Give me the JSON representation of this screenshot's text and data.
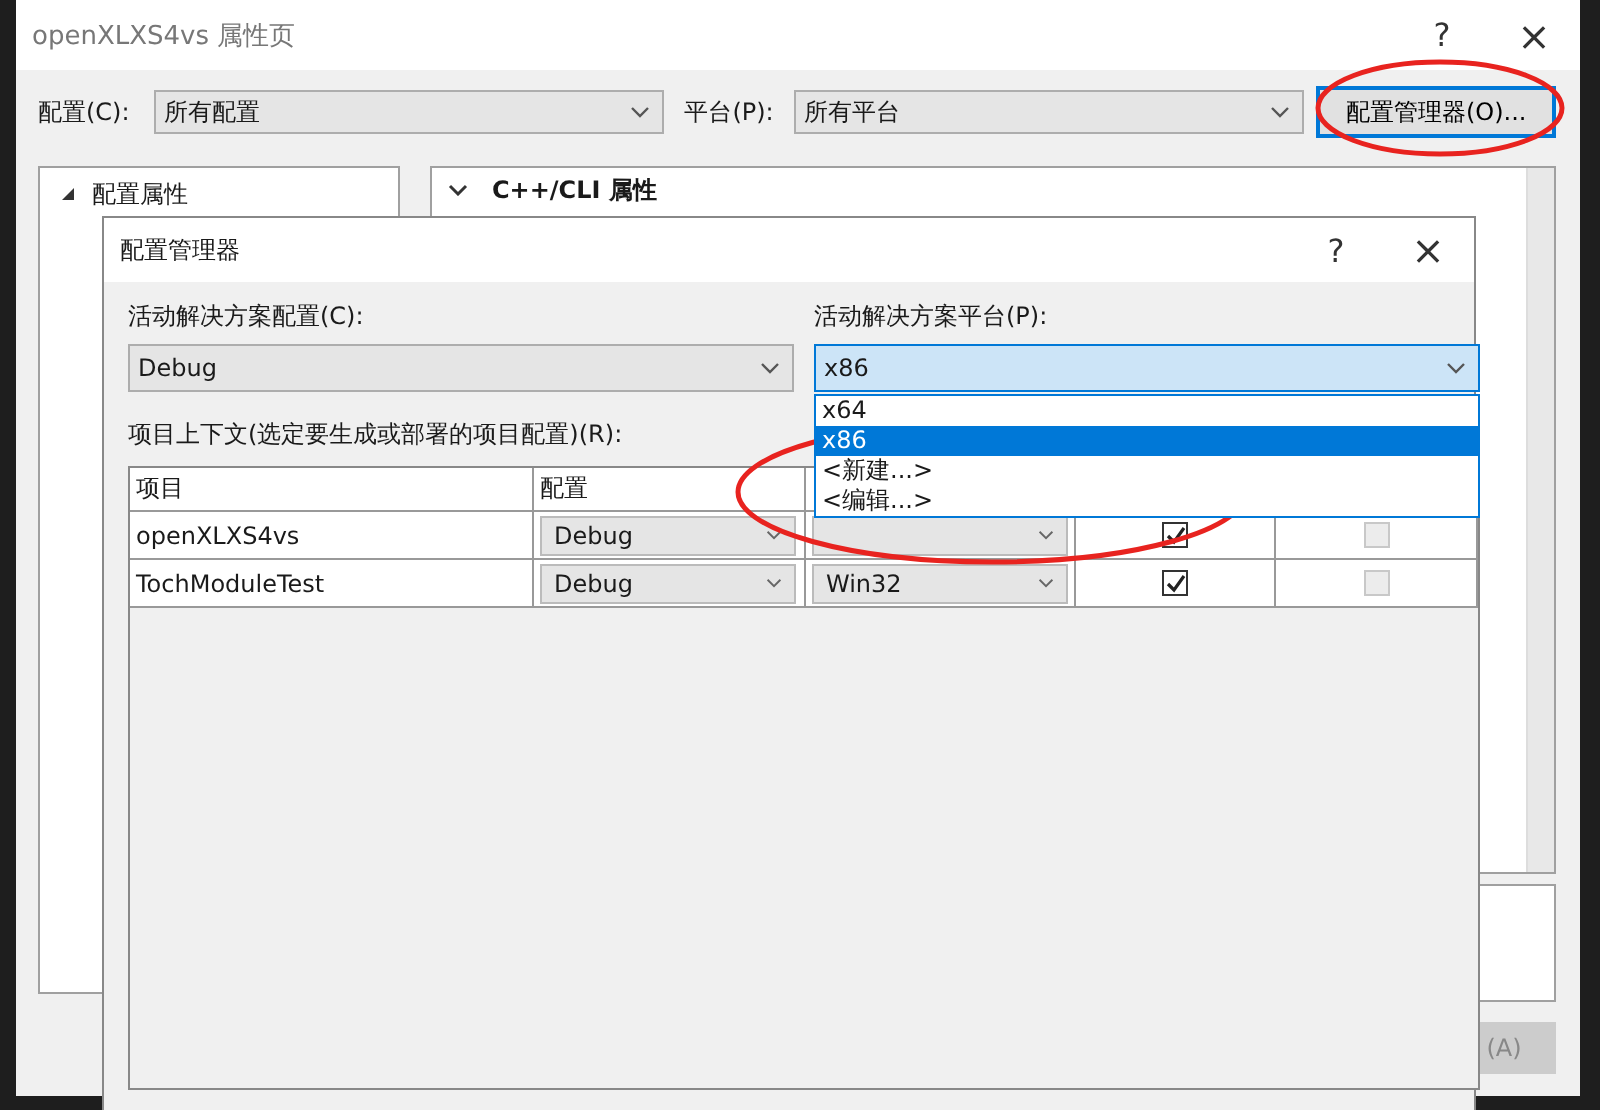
{
  "window": {
    "title": "openXLXS4vs 属性页",
    "help": "?",
    "close": "×"
  },
  "toolbar": {
    "config_label": "配置(C):",
    "config_value": "所有配置",
    "platform_label": "平台(P):",
    "platform_value": "所有平台",
    "manager_button": "配置管理器(O)..."
  },
  "tree": [
    {
      "label": "配置属性",
      "expanded": true
    }
  ],
  "property_header": {
    "title": "C++/CLI 属性",
    "expanded": true
  },
  "apply_button": "(A)",
  "dialog": {
    "title": "配置管理器",
    "help": "?",
    "close": "×",
    "solution_config": {
      "label": "活动解决方案配置(C):",
      "value": "Debug"
    },
    "solution_platform": {
      "label": "活动解决方案平台(P):",
      "value": "x86",
      "open": true,
      "options": [
        {
          "label": "x64",
          "selected": false
        },
        {
          "label": "x86",
          "selected": true
        },
        {
          "label": "<新建...>",
          "selected": false
        },
        {
          "label": "<编辑...>",
          "selected": false
        }
      ]
    },
    "projects_label": "项目上下文(选定要生成或部署的项目配置)(R):",
    "columns": [
      "项目",
      "配置"
    ],
    "rows": [
      {
        "project": "openXLXS4vs",
        "config": "Debug",
        "column_4": {
          "checked": true,
          "disabled": false
        },
        "column_5": {
          "checked": false,
          "disabled": true
        }
      },
      {
        "project": "TochModuleTest",
        "config": "Debug",
        "platform": "Win32",
        "column_4": {
          "checked": true,
          "disabled": false
        },
        "column_5": {
          "checked": false,
          "disabled": true
        }
      }
    ]
  }
}
